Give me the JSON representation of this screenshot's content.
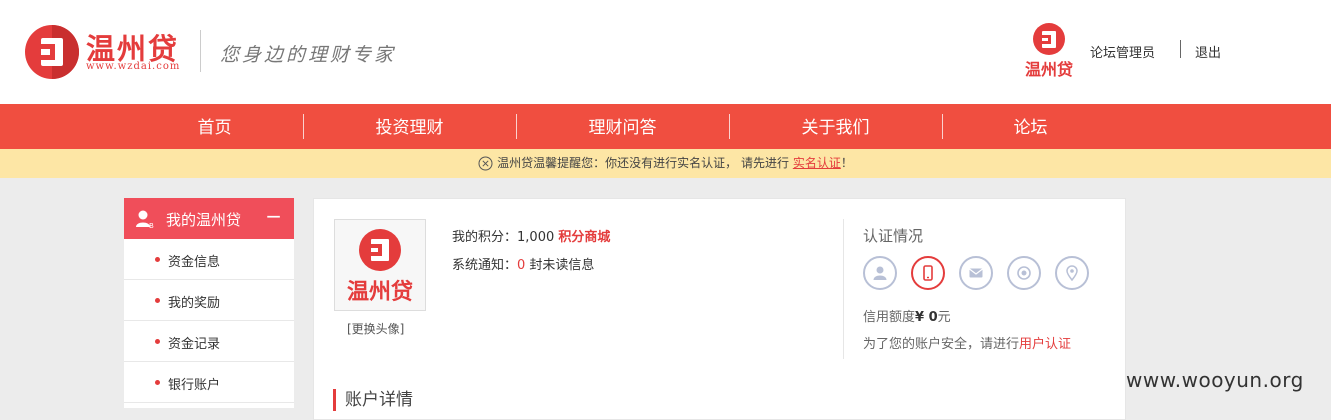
{
  "header": {
    "brand_name": "温州贷",
    "brand_url": "www.wzdai.com",
    "slogan": "您身边的理财专家",
    "user_name": "论坛管理员",
    "logout_label": "退出",
    "avatar_text": "温州贷"
  },
  "nav": {
    "items": [
      {
        "label": "首页"
      },
      {
        "label": "投资理财"
      },
      {
        "label": "理财问答"
      },
      {
        "label": "关于我们"
      },
      {
        "label": "论坛"
      }
    ]
  },
  "notice": {
    "text": "温州贷温馨提醒您：你还没有进行实名认证， 请先进行",
    "link_label": "实名认证",
    "suffix": "！"
  },
  "sidebar": {
    "title": "我的温州贷",
    "toggle": "−",
    "items": [
      {
        "label": "资金信息"
      },
      {
        "label": "我的奖励"
      },
      {
        "label": "资金记录"
      },
      {
        "label": "银行账户"
      }
    ]
  },
  "profile": {
    "avatar_text": "温州贷",
    "change_avatar_label": "[更换头像]",
    "points_label": "我的积分：",
    "points_value": "1,000",
    "points_mall_label": "积分商城",
    "notify_label": "系统通知：",
    "notify_count": "0",
    "notify_suffix": " 封未读信息"
  },
  "certification": {
    "title": "认证情况",
    "icons": [
      {
        "name": "user-icon",
        "active": false
      },
      {
        "name": "mobile-icon",
        "active": true
      },
      {
        "name": "mail-icon",
        "active": false
      },
      {
        "name": "vip-icon",
        "active": false
      },
      {
        "name": "location-icon",
        "active": false
      }
    ],
    "credit_label": "信用额度",
    "credit_value": "¥ 0",
    "credit_unit": "元",
    "security_text": "为了您的账户安全，请进行",
    "security_link": "用户认证"
  },
  "account": {
    "title": "账户详情"
  },
  "watermark": "www.wooyun.org",
  "colors": {
    "brand_red": "#e43c3c",
    "nav_red": "#f04e40",
    "sidebar_red": "#f04e5a",
    "notice_bg": "#fde6a5",
    "page_bg": "#ececec"
  }
}
